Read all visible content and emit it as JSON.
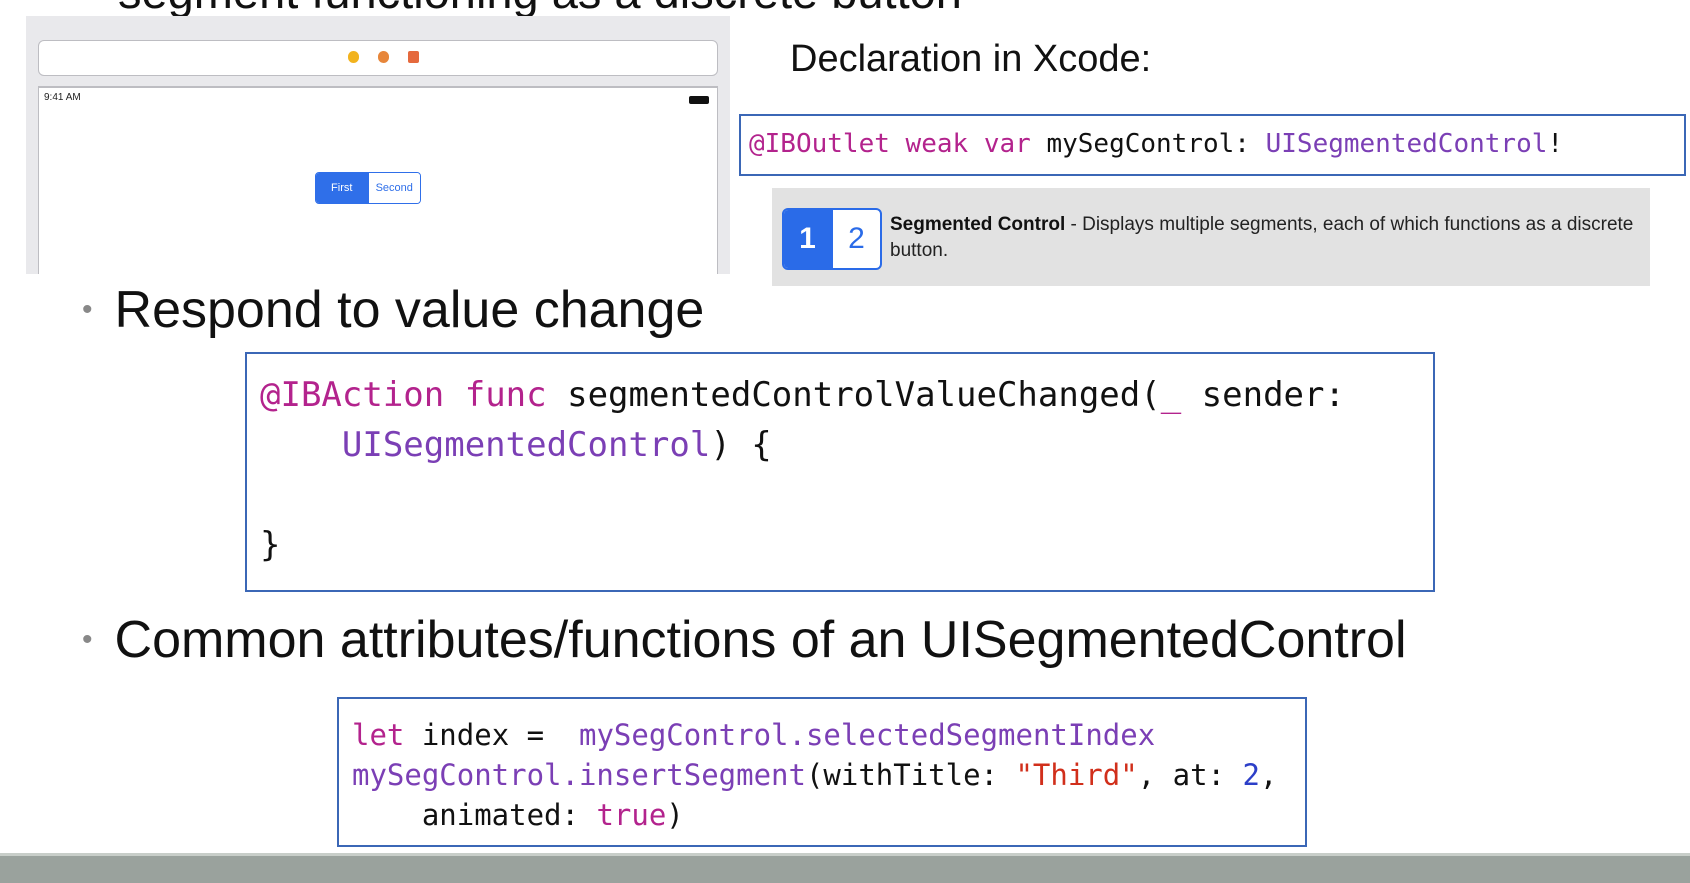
{
  "top_heading": "segment functioning as a discrete button",
  "simulator": {
    "status_time": "9:41 AM",
    "segments": [
      "First",
      "Second"
    ],
    "toolbar_colors": [
      "#f2b31e",
      "#e7863a",
      "#e5693d"
    ]
  },
  "declaration": {
    "label": "Declaration in Xcode:",
    "code": {
      "kw1": "@IBOutlet",
      "kw2": "weak",
      "kw3": "var",
      "name": "mySegControl:",
      "type": "UISegmentedControl",
      "suffix": "!"
    }
  },
  "library_item": {
    "seg1": "1",
    "seg2": "2",
    "title": "Segmented Control",
    "description": " - Displays multiple segments, each of which functions as a discrete button."
  },
  "bullets": {
    "respond": "Respond to value change",
    "common": "Common attributes/functions of an UISegmentedControl"
  },
  "action_code": {
    "kw1": "@IBAction",
    "kw2": "func",
    "fn": "segmentedControlValueChanged(",
    "underscore": "_",
    "param": " sender:",
    "type": "UISegmentedControl",
    "close": ") {",
    "brace": "}"
  },
  "attr_code": {
    "let": "let",
    "var_part": " index =  ",
    "obj1": "mySegControl",
    "prop": ".selectedSegmentIndex",
    "obj2": "mySegControl",
    "method": ".insertSegment",
    "args1": "(withTitle: ",
    "str": "\"Third\"",
    "args2": ", at: ",
    "num": "2",
    "args3": ",",
    "animated": "    animated: ",
    "true": "true",
    "end": ")"
  },
  "colors": {
    "keyword": "#b3238d",
    "type": "#7b3fb5",
    "string": "#d12f1b",
    "number": "#2c3fc8",
    "box_border": "#3b67b6",
    "segment_blue": "#2f6fe9",
    "footer": "#9aa29d"
  }
}
